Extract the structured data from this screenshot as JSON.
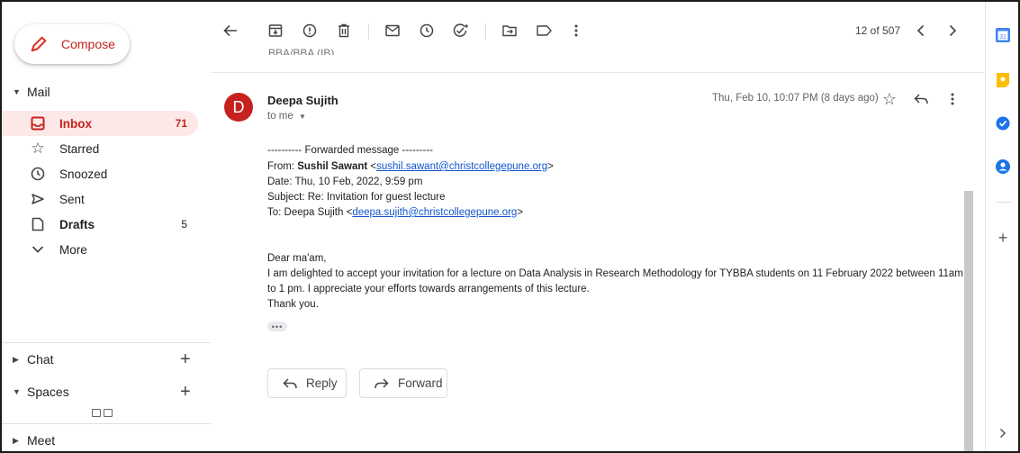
{
  "sidebar": {
    "compose_label": "Compose",
    "mail_section": "Mail",
    "items": [
      {
        "label": "Inbox",
        "count": "71"
      },
      {
        "label": "Starred",
        "count": ""
      },
      {
        "label": "Snoozed",
        "count": ""
      },
      {
        "label": "Sent",
        "count": ""
      },
      {
        "label": "Drafts",
        "count": "5"
      },
      {
        "label": "More",
        "count": ""
      }
    ],
    "chat_label": "Chat",
    "spaces_label": "Spaces",
    "meet_label": "Meet"
  },
  "toolbar": {
    "counter": "12 of 507",
    "icons": [
      "back-arrow-icon",
      "archive-icon",
      "report-spam-icon",
      "delete-icon",
      "mark-unread-icon",
      "snooze-icon",
      "add-task-icon",
      "move-to-icon",
      "label-icon",
      "more-vert-icon",
      "prev-icon",
      "next-icon"
    ]
  },
  "message": {
    "prev_cut_text": "BBA/BBA (IB)",
    "avatar_letter": "D",
    "sender": "Deepa Sujith",
    "to": "to me",
    "date": "Thu, Feb 10, 10:07 PM (8 days ago)",
    "fwd_header": "---------- Forwarded message ---------",
    "from_label": "From: ",
    "from_name": "Sushil Sawant",
    "from_email": "sushil.sawant@christcollegepune.org",
    "date_line": "Date: Thu, 10 Feb, 2022, 9:59 pm",
    "subject_line": "Subject: Re: Invitation for guest lecture",
    "to_label": "To: Deepa Sujith ",
    "to_email": "deepa.sujith@christcollegepune.org",
    "greeting": "Dear ma'am,",
    "body_line1": "I am delighted to accept your invitation for a lecture on Data Analysis in Research Methodology for TYBBA students on 11 February 2022 between 11am",
    "body_line2": "to 1 pm. I appreciate your efforts towards arrangements of this lecture.",
    "thanks": "Thank you.",
    "ellipsis": "•••"
  },
  "actions": {
    "reply": "Reply",
    "forward": "Forward"
  },
  "colors": {
    "accent_red": "#c5221f",
    "active_bg": "#fce8e6",
    "link": "#1155cc"
  }
}
